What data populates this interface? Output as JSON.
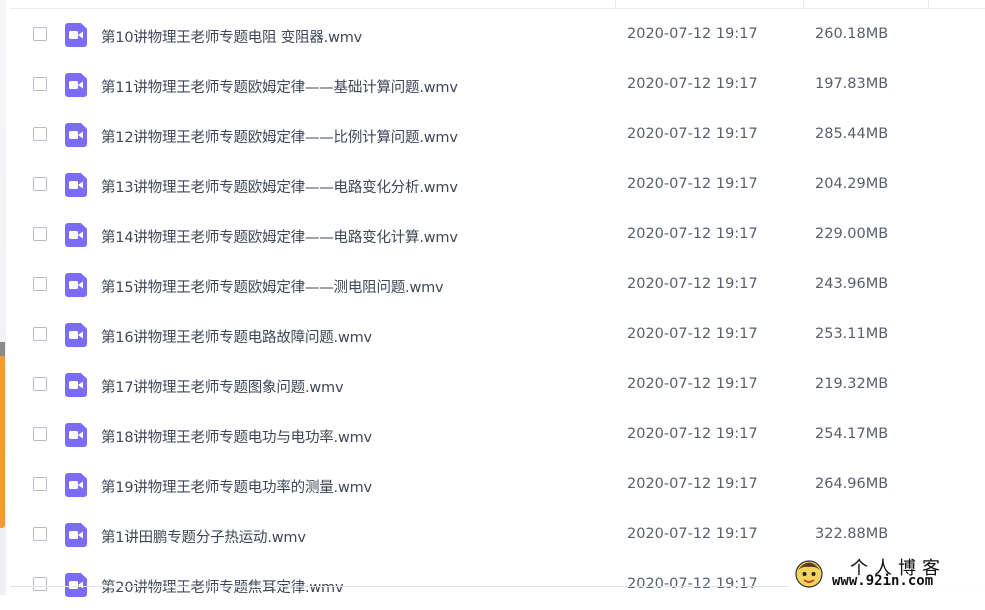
{
  "files": [
    {
      "name": "第10讲物理王老师专题电阻 变阻器.wmv",
      "date": "2020-07-12 19:17",
      "size": "260.18MB"
    },
    {
      "name": "第11讲物理王老师专题欧姆定律——基础计算问题.wmv",
      "date": "2020-07-12 19:17",
      "size": "197.83MB"
    },
    {
      "name": "第12讲物理王老师专题欧姆定律——比例计算问题.wmv",
      "date": "2020-07-12 19:17",
      "size": "285.44MB"
    },
    {
      "name": "第13讲物理王老师专题欧姆定律——电路变化分析.wmv",
      "date": "2020-07-12 19:17",
      "size": "204.29MB"
    },
    {
      "name": "第14讲物理王老师专题欧姆定律——电路变化计算.wmv",
      "date": "2020-07-12 19:17",
      "size": "229.00MB"
    },
    {
      "name": "第15讲物理王老师专题欧姆定律——测电阻问题.wmv",
      "date": "2020-07-12 19:17",
      "size": "243.96MB"
    },
    {
      "name": "第16讲物理王老师专题电路故障问题.wmv",
      "date": "2020-07-12 19:17",
      "size": "253.11MB"
    },
    {
      "name": "第17讲物理王老师专题图象问题.wmv",
      "date": "2020-07-12 19:17",
      "size": "219.32MB"
    },
    {
      "name": "第18讲物理王老师专题电功与电功率.wmv",
      "date": "2020-07-12 19:17",
      "size": "254.17MB"
    },
    {
      "name": "第19讲物理王老师专题电功率的测量.wmv",
      "date": "2020-07-12 19:17",
      "size": "264.96MB"
    },
    {
      "name": "第1讲田鹏专题分子热运动.wmv",
      "date": "2020-07-12 19:17",
      "size": "322.88MB"
    },
    {
      "name": "第20讲物理王老师专题焦耳定律.wmv",
      "date": "2020-07-12 19:17",
      "size": ""
    }
  ],
  "watermark": {
    "title": "个人博客",
    "url": "www.92in.com"
  },
  "colors": {
    "file_icon": "#7b6cf6",
    "side_accent": "#f49a3a",
    "text": "#3f4756",
    "meta_text": "#59606c"
  },
  "icons": {
    "row_checkbox": "checkbox-icon",
    "video_file": "video-file-icon",
    "mascot": "mascot-icon"
  }
}
